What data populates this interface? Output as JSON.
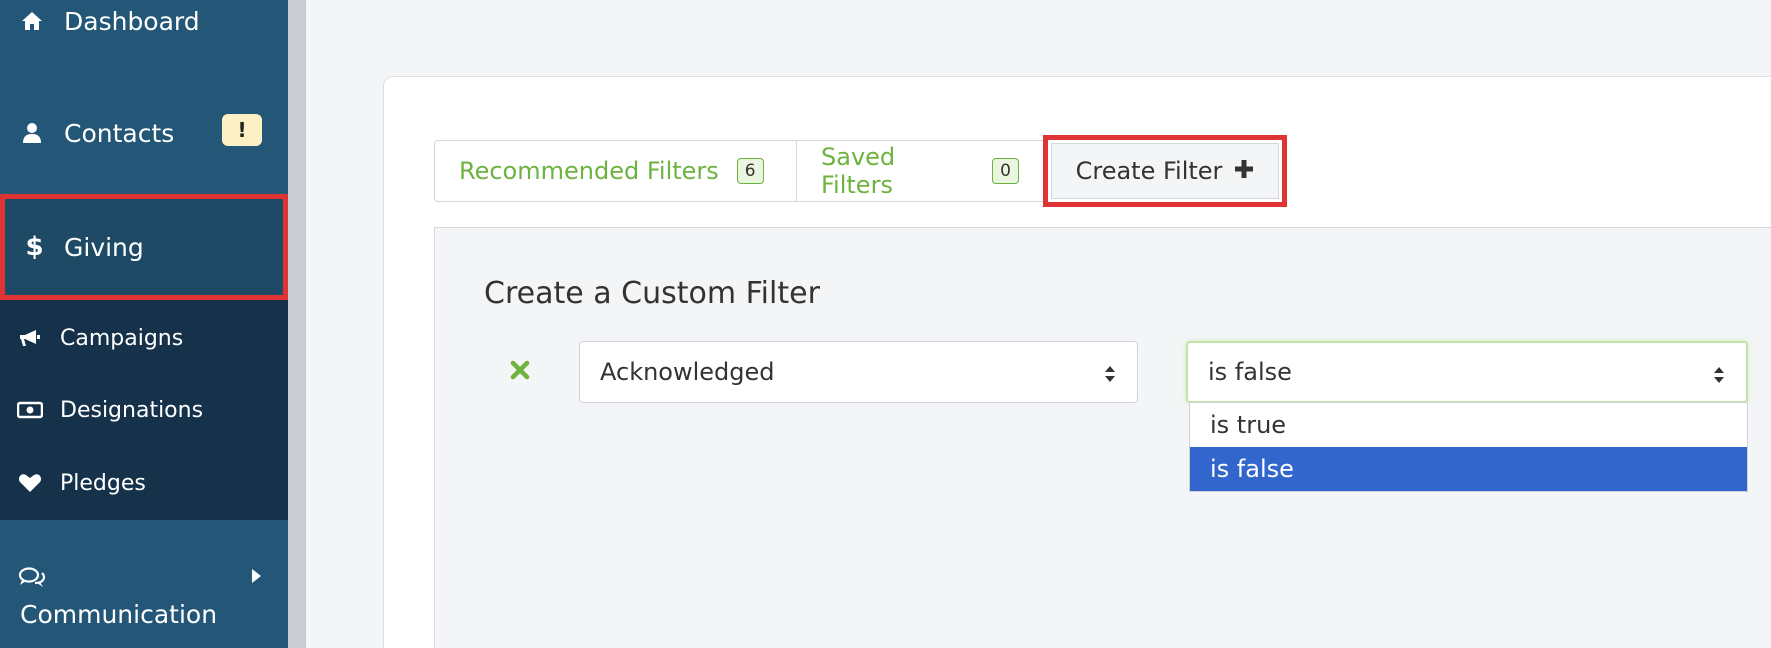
{
  "sidebar": {
    "dashboard": "Dashboard",
    "contacts": "Contacts",
    "contacts_badge": "!",
    "giving": "Giving",
    "campaigns": "Campaigns",
    "designations": "Designations",
    "pledges": "Pledges",
    "communication": "Communication"
  },
  "tabs": {
    "recommended": {
      "label": "Recommended Filters",
      "count": "6"
    },
    "saved": {
      "label": "Saved Filters",
      "count": "0"
    },
    "create": {
      "label": "Create Filter"
    }
  },
  "panel": {
    "title": "Create a Custom Filter",
    "field_select_value": "Acknowledged",
    "operator_select_value": "is false",
    "operator_options": [
      "is true",
      "is false"
    ],
    "selected_option": "is false"
  },
  "colors": {
    "sidebar": "#245777",
    "sidebar_sub": "#16324b",
    "accent_green": "#6db33f",
    "highlight_red": "#e03333",
    "option_selected": "#3366cc"
  }
}
